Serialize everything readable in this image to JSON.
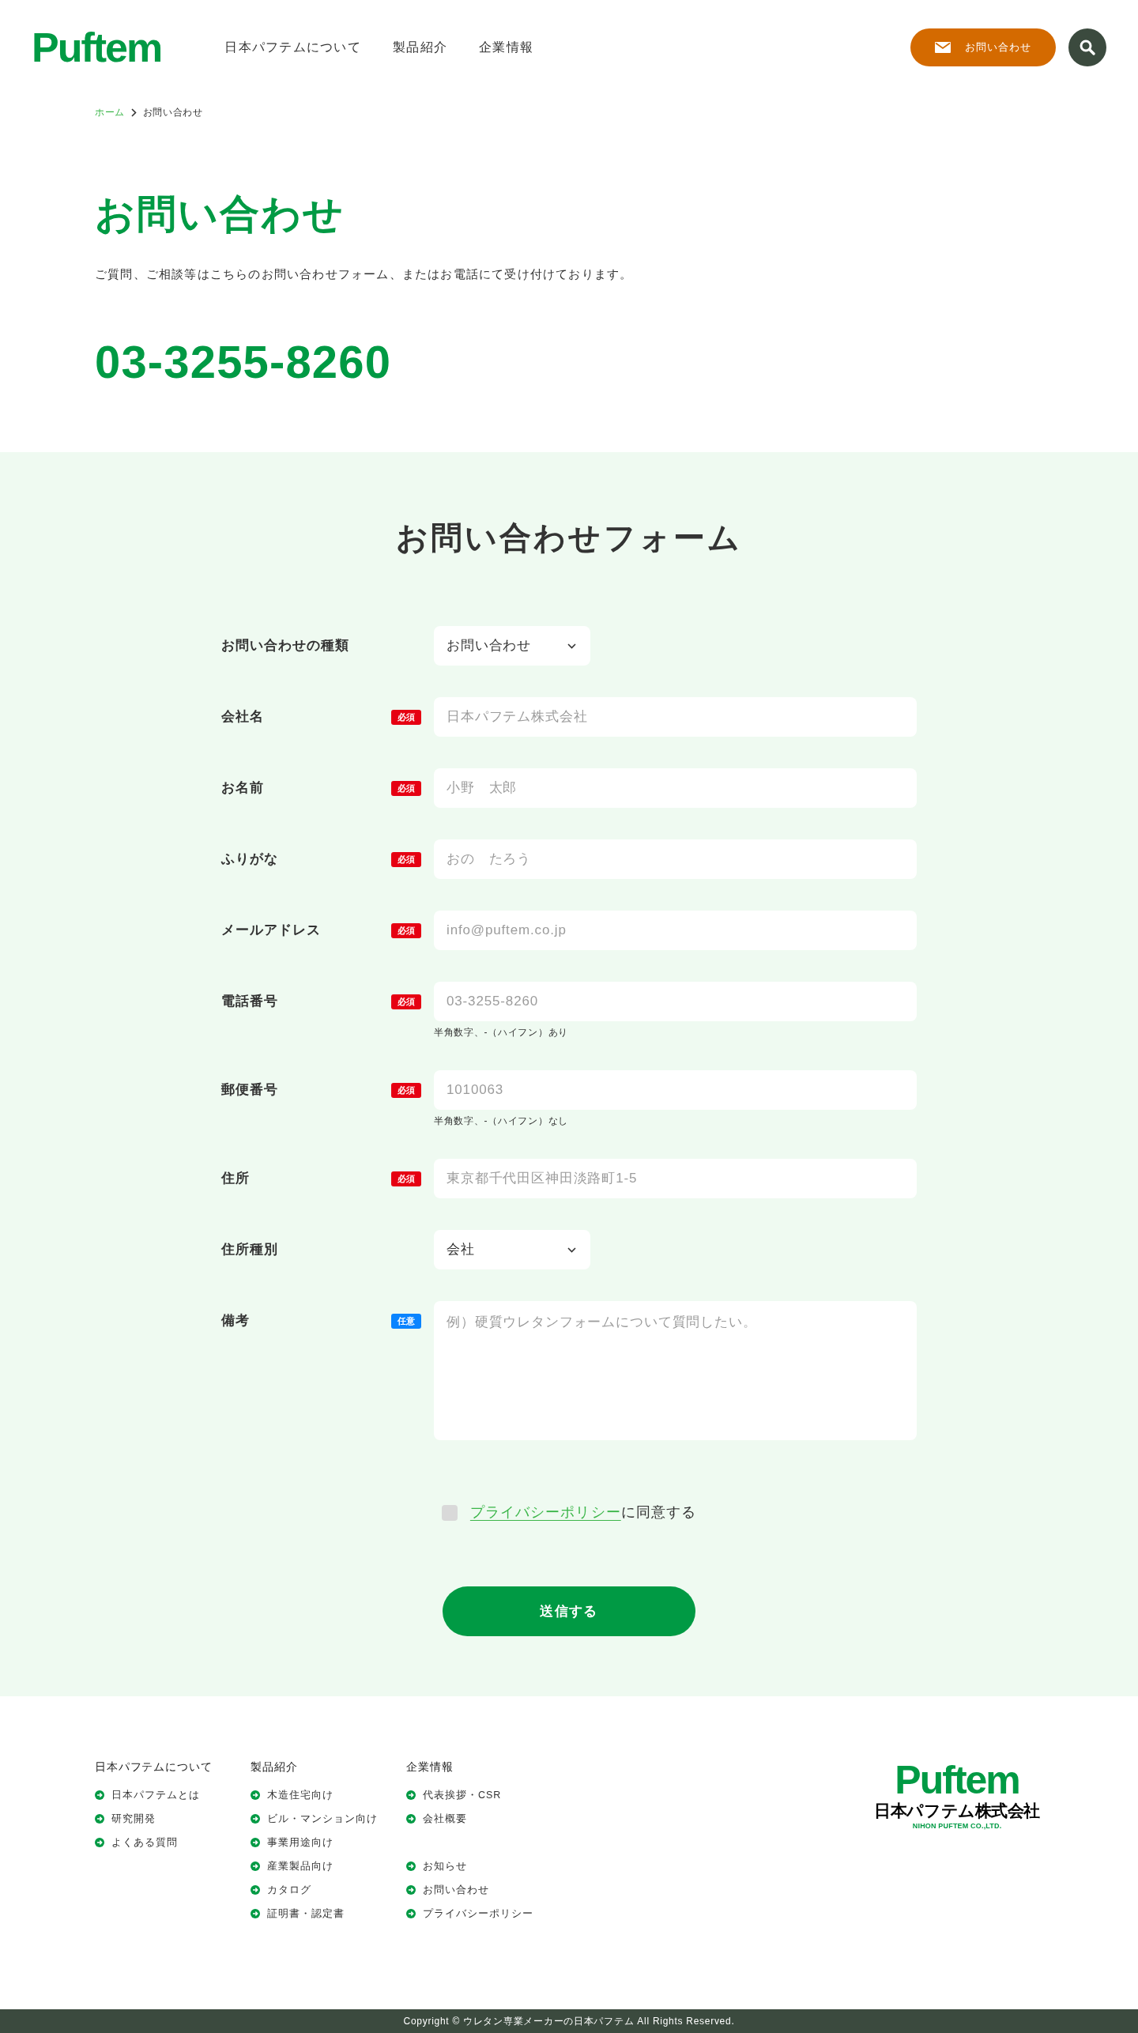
{
  "header": {
    "logo": "Puftem",
    "nav": [
      "日本パフテムについて",
      "製品紹介",
      "企業情報"
    ],
    "contact_button": "お問い合わせ"
  },
  "breadcrumb": [
    {
      "label": "ホーム",
      "current": false
    },
    {
      "label": "お問い合わせ",
      "current": true
    }
  ],
  "intro": {
    "title": "お問い合わせ",
    "description": "ご質問、ご相談等はこちらのお問い合わせフォーム、またはお電話にて受け付けております。",
    "phone": "03-3255-8260"
  },
  "form": {
    "title": "お問い合わせフォーム",
    "fields": [
      {
        "kind": "select",
        "label": "お問い合わせの種類",
        "value": "お問い合わせ"
      },
      {
        "kind": "text",
        "label": "会社名",
        "badge": {
          "label": "必須",
          "required": true
        },
        "placeholder": "日本パフテム株式会社"
      },
      {
        "kind": "text",
        "label": "お名前",
        "badge": {
          "label": "必須",
          "required": true
        },
        "placeholder": "小野　太郎"
      },
      {
        "kind": "text",
        "label": "ふりがな",
        "badge": {
          "label": "必須",
          "required": true
        },
        "placeholder": "おの　たろう"
      },
      {
        "kind": "text",
        "label": "メールアドレス",
        "badge": {
          "label": "必須",
          "required": true
        },
        "placeholder": "info@puftem.co.jp"
      },
      {
        "kind": "text",
        "label": "電話番号",
        "badge": {
          "label": "必須",
          "required": true
        },
        "placeholder": "03-3255-8260",
        "note": "半角数字、-（ハイフン）あり"
      },
      {
        "kind": "text",
        "label": "郵便番号",
        "badge": {
          "label": "必須",
          "required": true
        },
        "placeholder": "1010063",
        "note": "半角数字、-（ハイフン）なし"
      },
      {
        "kind": "text",
        "label": "住所",
        "badge": {
          "label": "必須",
          "required": true
        },
        "placeholder": "東京都千代田区神田淡路町1-5"
      },
      {
        "kind": "select",
        "label": "住所種別",
        "value": "会社"
      },
      {
        "kind": "textarea",
        "label": "備考",
        "badge": {
          "label": "任意",
          "required": false
        },
        "placeholder": "例）硬質ウレタンフォームについて質問したい。"
      }
    ],
    "consent": {
      "checked": false,
      "link": "プライバシーポリシー",
      "text": "に同意する"
    },
    "submit": "送信する"
  },
  "footer": {
    "columns": [
      {
        "heading": "日本パフテムについて",
        "groups": [
          [
            "日本パフテムとは",
            "研究開発",
            "よくある質問"
          ]
        ]
      },
      {
        "heading": "製品紹介",
        "groups": [
          [
            "木造住宅向け",
            "ビル・マンション向け",
            "事業用途向け",
            "産業製品向け",
            "カタログ",
            "証明書・認定書"
          ]
        ]
      },
      {
        "heading": "企業情報",
        "groups": [
          [
            "代表挨拶・CSR",
            "会社概要"
          ],
          [
            "お知らせ",
            "お問い合わせ",
            "プライバシーポリシー"
          ]
        ]
      }
    ],
    "logo": {
      "wordmark": "Puftem",
      "name": "日本パフテム株式会社",
      "name_en": "NIHON PUFTEM CO.,LTD."
    },
    "copyright": "Copyright © ウレタン専業メーカーの日本パフテム All Rights Reserved."
  }
}
